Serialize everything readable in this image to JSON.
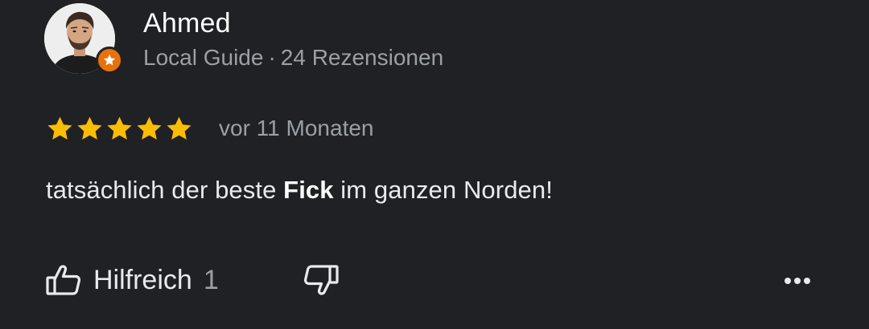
{
  "author": {
    "name": "Ahmed",
    "level": "Local Guide",
    "separator": "·",
    "reviews_count": "24 Rezensionen"
  },
  "review": {
    "rating": 5,
    "rating_max": 5,
    "date": "vor 11 Monaten",
    "text_before": "tatsächlich der beste ",
    "text_bold": "Fick",
    "text_after": " im ganzen Norden!"
  },
  "actions": {
    "helpful_label": "Hilfreich",
    "helpful_count": "1"
  },
  "icons": {
    "like": "thumbs-up-icon",
    "dislike": "thumbs-down-icon",
    "more": "more-horizontal-icon",
    "badge": "local-guide-star-icon"
  },
  "colors": {
    "background": "#202124",
    "star": "#fbbc04",
    "badge": "#e8710a",
    "secondary_text": "#9aa0a6"
  }
}
